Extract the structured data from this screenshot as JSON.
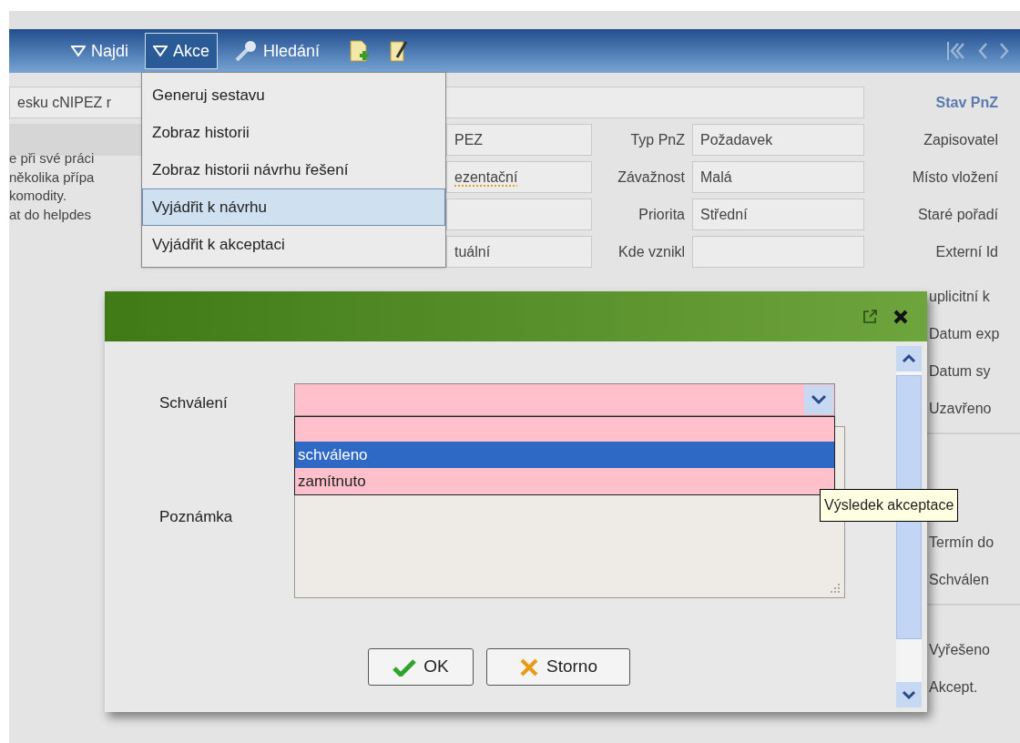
{
  "toolbar": {
    "items": [
      {
        "kind": "dropdown",
        "label": "Najdi",
        "selected": false
      },
      {
        "kind": "dropdown",
        "label": "Akce",
        "selected": true
      },
      {
        "kind": "search",
        "label": "Hledání"
      }
    ]
  },
  "form": {
    "header_field": "esku cNIPEZ r",
    "status_heading": "Stav PnZ",
    "description": [
      "e při své práci",
      "několika přípa",
      "komodity.",
      "at do helpdes"
    ],
    "rows": [
      {
        "field": "PEZ",
        "label": "Typ PnZ",
        "value": "Požadavek",
        "side_label": "Zapisovatel"
      },
      {
        "field": "ezentační",
        "spell_error": true,
        "label": "Závažnost",
        "value": "Malá",
        "side_label": "Místo vložení"
      },
      {
        "label": "Priorita",
        "value": "Střední",
        "side_label": "Staré pořadí"
      },
      {
        "field": "tuální",
        "label": "Kde vznikl",
        "side_label": "Externí Id"
      }
    ],
    "side_label_groups": [
      [
        "uplicitní k",
        "Datum exp",
        "Datum sy",
        "Uzavřeno"
      ],
      [
        "Termín do",
        "Schválen"
      ],
      [
        "Vyřešeno",
        "Akcept."
      ]
    ]
  },
  "actions_menu": [
    {
      "label": "Generuj sestavu",
      "selected": false
    },
    {
      "label": "Zobraz historii",
      "selected": false
    },
    {
      "label": "Zobraz historii návrhu řešení",
      "selected": false
    },
    {
      "label": "Vyjádřit k návrhu",
      "selected": true
    },
    {
      "label": "Vyjádřit k akceptaci",
      "selected": false
    }
  ],
  "dialog": {
    "approval": {
      "label": "Schválení",
      "expanded": true,
      "options": [
        {
          "label": "schváleno",
          "selected": true
        },
        {
          "label": "zamítnuto",
          "selected": false
        }
      ]
    },
    "note": {
      "label": "Poznámka"
    },
    "buttons": [
      {
        "kind": "ok",
        "label": "OK"
      },
      {
        "kind": "cancel",
        "label": "Storno"
      }
    ],
    "tooltip": "Výsledek akceptace"
  }
}
